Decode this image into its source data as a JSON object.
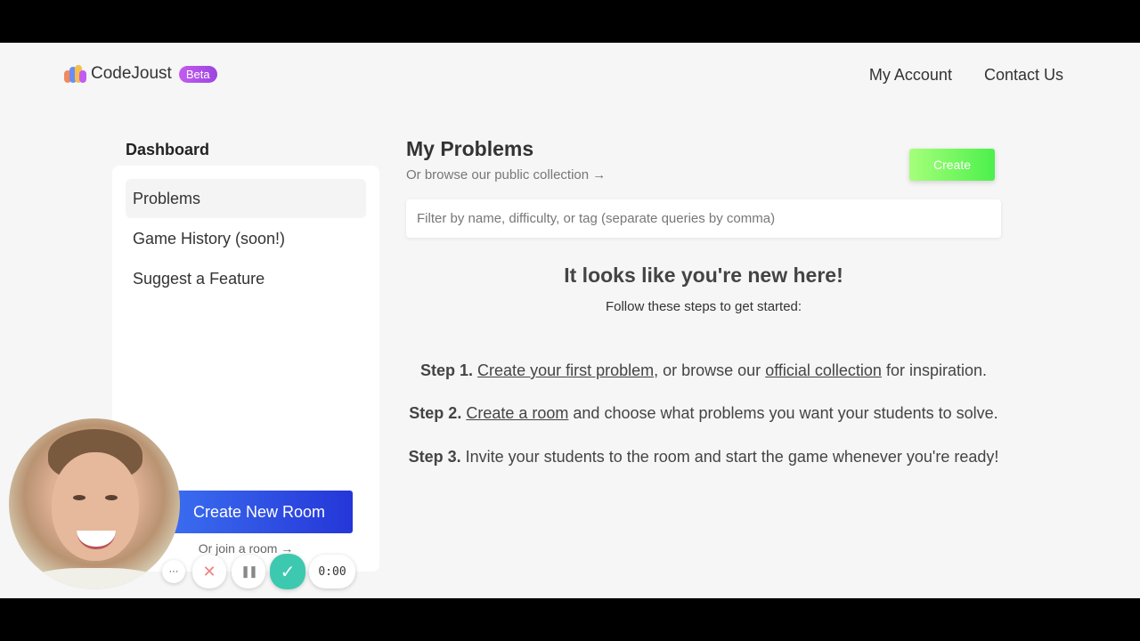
{
  "header": {
    "brand": "CodeJoust",
    "badge": "Beta",
    "nav": [
      "My Account",
      "Contact Us"
    ]
  },
  "sidebar": {
    "title": "Dashboard",
    "items": [
      {
        "label": "Problems",
        "active": true
      },
      {
        "label": "Game History (soon!)",
        "active": false
      },
      {
        "label": "Suggest a Feature",
        "active": false
      }
    ],
    "create_room_label": "Create New Room",
    "join_room_label": "Or join a room →"
  },
  "main": {
    "title": "My Problems",
    "subtitle": "Or browse our public collection →",
    "create_label": "Create",
    "filter_placeholder": "Filter by name, difficulty, or tag (separate queries by comma)",
    "welcome_title": "It looks like you're new here!",
    "welcome_sub": "Follow these steps to get started:",
    "steps": [
      {
        "label": "Step 1.",
        "link1": "Create your first problem",
        "text1": ", or browse our ",
        "link2": "official collection",
        "text2": " for inspiration."
      },
      {
        "label": "Step 2.",
        "link1": "Create a room",
        "text1": " and choose what problems you want your students to solve."
      },
      {
        "label": "Step 3.",
        "text1": " Invite your students to the room and start the game whenever you're ready!"
      }
    ]
  },
  "recorder": {
    "more_label": "···",
    "cancel_icon": "✕",
    "pause_icon": "❚❚",
    "done_icon": "✓",
    "timer": "0:00"
  },
  "colors": {
    "page_bg": "#f6f6f6",
    "beta": "#b250ea",
    "create_room": "#2f4fe4",
    "create": "#6cf05a",
    "done": "#3cc9b0"
  }
}
